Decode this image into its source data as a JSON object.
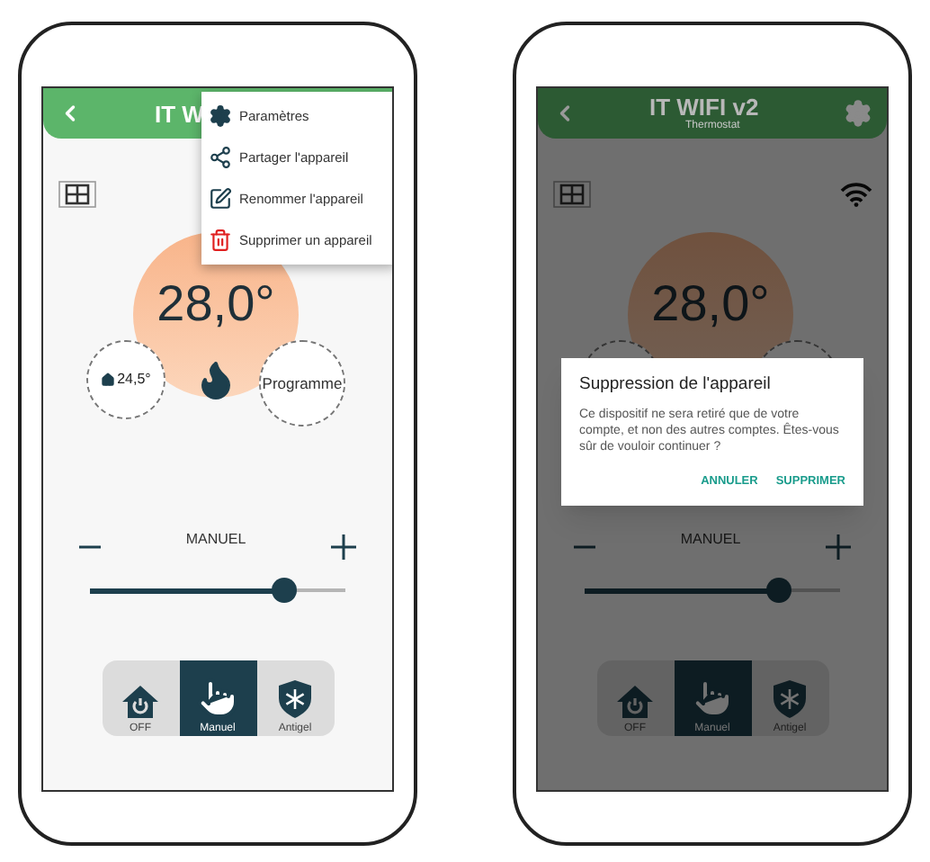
{
  "phones": [
    {
      "header": {
        "title": "IT W",
        "settings_button": false
      },
      "setpoint": "28,0°",
      "ambient": "24,5°",
      "program": "Programme",
      "mode_label": "MANUEL",
      "slider": {
        "level": 0.76
      },
      "modes": [
        {
          "kind": "off",
          "label": "OFF",
          "selected": false
        },
        {
          "kind": "manual",
          "label": "Manuel",
          "selected": true
        },
        {
          "kind": "frost",
          "label": "Antigel",
          "selected": false
        }
      ],
      "menu": {
        "items": [
          {
            "kind": "settings",
            "label": "Paramètres"
          },
          {
            "kind": "share",
            "label": "Partager l'appareil"
          },
          {
            "kind": "rename",
            "label": "Renommer l'appareil"
          },
          {
            "kind": "delete",
            "label": "Supprimer un appareil"
          }
        ]
      }
    },
    {
      "header": {
        "title": "IT WIFI v2",
        "subtitle": "Thermostat",
        "settings_button": true
      },
      "setpoint": "28,0°",
      "mode_label": "MANUEL",
      "slider": {
        "level": 0.76
      },
      "modes": [
        {
          "kind": "off",
          "label": "OFF",
          "selected": false
        },
        {
          "kind": "manual",
          "label": "Manuel",
          "selected": true
        },
        {
          "kind": "frost",
          "label": "Antigel",
          "selected": false
        }
      ],
      "dialog": {
        "title": "Suppression de l'appareil",
        "message": "Ce dispositif ne sera retiré que de votre compte, et non des autres comptes. Êtes-vous sûr de vouloir continuer ?",
        "buttons": [
          "ANNULER",
          "SUPPRIMER"
        ]
      }
    }
  ]
}
